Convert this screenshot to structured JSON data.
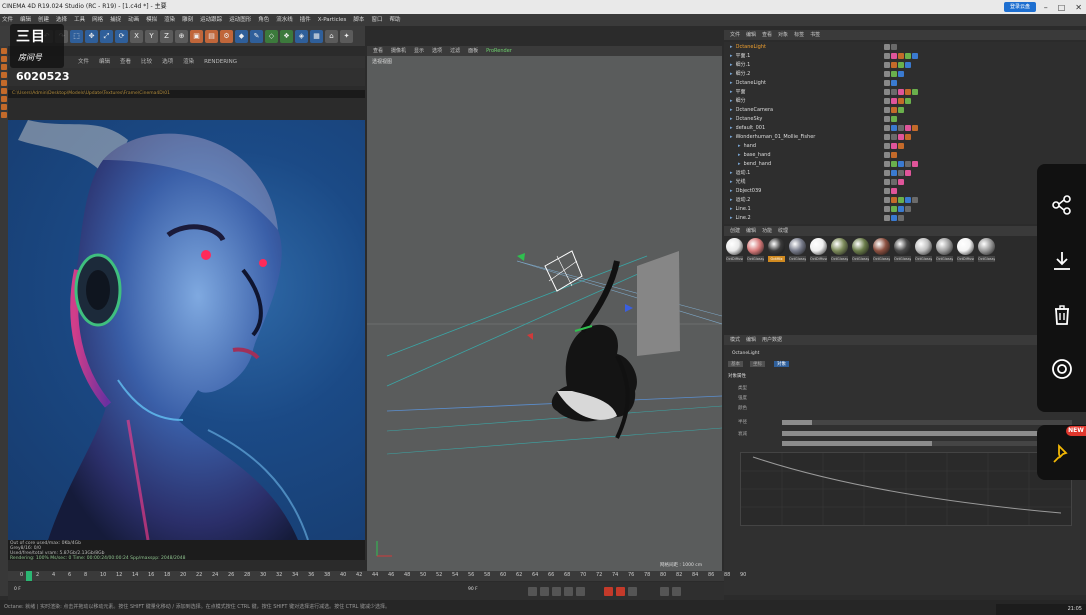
{
  "titlebar": {
    "title": "CINEMA 4D R19.024 Studio (RC - R19) - [1.c4d *] - 主要",
    "cloud_button": "登录云盘"
  },
  "menubar": [
    "文件",
    "编辑",
    "创建",
    "选择",
    "工具",
    "网格",
    "捕捉",
    "动画",
    "模拟",
    "渲染",
    "雕刻",
    "运动跟踪",
    "运动图形",
    "角色",
    "流水线",
    "插件",
    "X-Particles",
    "脚本",
    "窗口",
    "帮助"
  ],
  "logo": {
    "top": "三目",
    "bottom": "房间号"
  },
  "render_view": {
    "menu": [
      "文件",
      "编辑",
      "查看",
      "比较",
      "选项",
      "渲染"
    ],
    "renderer": "RENDERING",
    "frame_number": "6020523",
    "path": "C:\\Users\\Admin\\Desktop\\Models\\Update\\Textures\\Frame\\Cinema4D\\01",
    "info_left": [
      "Out of core used/max: 0Kb/4Gb",
      "Grey8/16: 0/0",
      "Rgb32/64: 0/0",
      "Used/free/total vram: 5.87Gb/2.13Gb/8Gb"
    ],
    "info_right": "Rendering: 100% Ms/sec: 0 Time: 00:00:24/00:00:24 Spp/maxspp: 2048/2048"
  },
  "viewport": {
    "menu": [
      "查看",
      "摄像机",
      "显示",
      "选项",
      "过滤",
      "面板",
      "ProRender"
    ],
    "label": "透视视图",
    "grid_spacing": "网格间距 : 1000 cm"
  },
  "object_manager": {
    "menu": [
      "文件",
      "编辑",
      "查看",
      "对象",
      "标签",
      "书签"
    ],
    "objects": [
      {
        "name": "OctaneLight",
        "selected": true
      },
      {
        "name": "平面.1"
      },
      {
        "name": "细分.1"
      },
      {
        "name": "细分.2"
      },
      {
        "name": "OctaneLight"
      },
      {
        "name": "平面"
      },
      {
        "name": "细分"
      },
      {
        "name": "OctaneCamera"
      },
      {
        "name": "OctaneSky"
      },
      {
        "name": "default_001"
      },
      {
        "name": "Wonderhuman_01_Mollie_Fisher"
      },
      {
        "name": "hand"
      },
      {
        "name": "base_hand"
      },
      {
        "name": "bend_hand"
      },
      {
        "name": "运动.1"
      },
      {
        "name": "光线"
      },
      {
        "name": "Object039"
      },
      {
        "name": "运动.2"
      },
      {
        "name": "Line.1"
      },
      {
        "name": "Line.2"
      }
    ]
  },
  "material_manager": {
    "menu": [
      "创建",
      "编辑",
      "功能",
      "纹理"
    ],
    "materials": [
      {
        "label": "OctDiffuse",
        "color": "#e8e8e8",
        "active": false
      },
      {
        "label": "OctGlossy",
        "color": "#d87a7a",
        "active": false
      },
      {
        "label": "OctMix",
        "color": "#3a3a3a",
        "active": true
      },
      {
        "label": "OctGlossy",
        "color": "#777b8a",
        "active": false
      },
      {
        "label": "OctDiffuse",
        "color": "#f0f0f0",
        "active": false
      },
      {
        "label": "OctGlossy",
        "color": "#7c8a5a",
        "active": false
      },
      {
        "label": "OctGlossy",
        "color": "#6a7c4a",
        "active": false
      },
      {
        "label": "OctGlossy",
        "color": "#8c5040",
        "active": false
      },
      {
        "label": "OctGlossy",
        "color": "#4a4a4a",
        "active": false
      },
      {
        "label": "OctGlossy",
        "color": "#c0c0c0",
        "active": false
      },
      {
        "label": "OctGlossy",
        "color": "#a0a0a0",
        "active": false
      },
      {
        "label": "OctDiffuse",
        "color": "#f4f4f4",
        "active": false
      },
      {
        "label": "OctGlossy",
        "color": "#9a9a9a",
        "active": false
      }
    ]
  },
  "attributes": {
    "menu": [
      "模式",
      "编辑",
      "用户数据"
    ],
    "tabs": [
      "基本",
      "坐标",
      "对象"
    ],
    "section": "对象属性",
    "fields": [
      "类型",
      "强度",
      "颜色",
      "半径",
      "衰减"
    ]
  },
  "timeline": {
    "numbers": [
      "0",
      "2",
      "4",
      "6",
      "8",
      "10",
      "12",
      "14",
      "16",
      "18",
      "20",
      "22",
      "24",
      "26",
      "28",
      "30",
      "32",
      "34",
      "36",
      "38",
      "40",
      "42",
      "44",
      "46",
      "48",
      "50",
      "52",
      "54",
      "56",
      "58",
      "60",
      "62",
      "64",
      "66",
      "68",
      "70",
      "72",
      "74",
      "76",
      "78",
      "80",
      "82",
      "84",
      "86",
      "88",
      "90"
    ],
    "current": "0 F",
    "end": "90 F"
  },
  "statusbar": "Octane: 就绪 | 实时渲染: 点击并拖动以移动元素。按住 SHIFT 键量化移动 / 添加到选择。在点模式按住 CTRL 键，按住 SHIFT 键对选择进行减选。按住 CTRL 键减少选择。",
  "taskbar_time": "21:05",
  "overlay": {
    "new_badge": "NEW",
    "actions": [
      "share",
      "download",
      "delete",
      "record"
    ]
  }
}
